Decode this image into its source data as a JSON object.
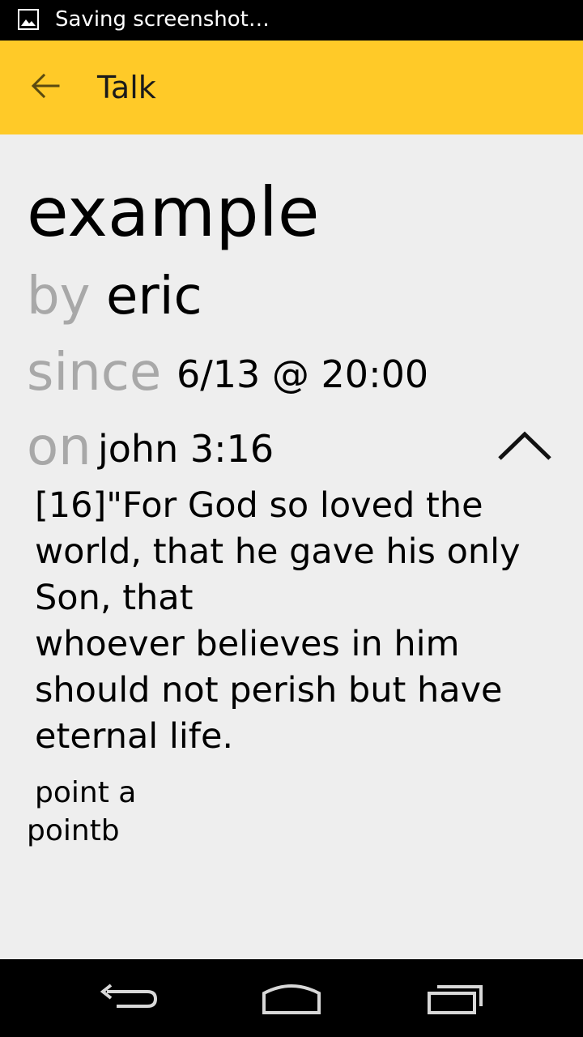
{
  "status_bar": {
    "notification_text": "Saving screenshot…",
    "icon": "image-icon"
  },
  "app_bar": {
    "title": "Talk",
    "back_icon": "arrow-left-icon",
    "background_color": "#ffca28"
  },
  "talk": {
    "title": "example",
    "by_label": "by",
    "author": "eric",
    "since_label": "since",
    "since_value": "6/13 @ 20:00",
    "on_label": "on",
    "reference": "john 3:16",
    "collapse_icon": "chevron-up-icon",
    "verse_lines": [
      "[16]\"For God so loved the",
      "world, that he gave his only",
      "Son, that",
      "whoever believes in him",
      "should not perish but have",
      "eternal life."
    ],
    "points": [
      "point a",
      "pointb"
    ]
  },
  "nav_bar": {
    "back_icon": "nav-back-icon",
    "home_icon": "nav-home-icon",
    "recents_icon": "nav-recents-icon"
  }
}
